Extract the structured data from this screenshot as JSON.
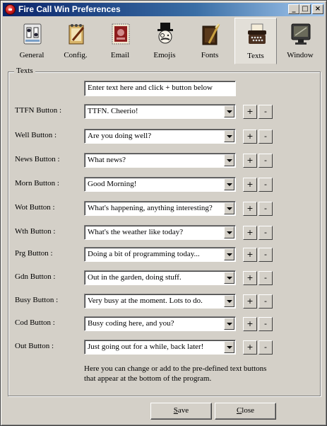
{
  "window": {
    "title": "Fire Call Win Preferences"
  },
  "tabs": [
    {
      "label": "General",
      "icon": "switch-panel-icon"
    },
    {
      "label": "Config.",
      "icon": "notepad-pen-icon"
    },
    {
      "label": "Email",
      "icon": "stamp-icon"
    },
    {
      "label": "Emojis",
      "icon": "monocle-man-icon"
    },
    {
      "label": "Fonts",
      "icon": "book-quill-icon"
    },
    {
      "label": "Texts",
      "icon": "typewriter-icon",
      "active": true
    },
    {
      "label": "Window",
      "icon": "monitor-icon"
    }
  ],
  "texts": {
    "group_title": "Texts",
    "new_text_field": "Enter text here and click + button below",
    "rows": [
      {
        "label": "TTFN Button :",
        "value": "TTFN. Cheerio!"
      },
      {
        "label": "Well Button :",
        "value": "Are you doing well?"
      },
      {
        "label": "News Button :",
        "value": "What news?"
      },
      {
        "label": "Morn Button :",
        "value": "Good Morning!"
      },
      {
        "label": "Wot Button :",
        "value": "What's happening, anything interesting?"
      },
      {
        "label": "Wth Button :",
        "value": "What's the weather like today?"
      },
      {
        "label": "Prg Button :",
        "value": "Doing a bit of programming today..."
      },
      {
        "label": "Gdn Button :",
        "value": "Out in the garden, doing stuff."
      },
      {
        "label": "Busy Button :",
        "value": "Very busy at the moment. Lots to do."
      },
      {
        "label": "Cod Button :",
        "value": "Busy coding here, and you?"
      },
      {
        "label": "Out Button :",
        "value": "Just going out for a while, back later!"
      }
    ],
    "add_label": "+",
    "remove_label": "-",
    "help_text": "Here you can change or add to the pre-defined text buttons that appear at the bottom of the program."
  },
  "buttons": {
    "save_accel": "S",
    "save_rest": "ave",
    "close_accel": "C",
    "close_rest": "lose"
  },
  "colors": {
    "title_bar": "#0a246a",
    "face": "#d4d0c8"
  }
}
